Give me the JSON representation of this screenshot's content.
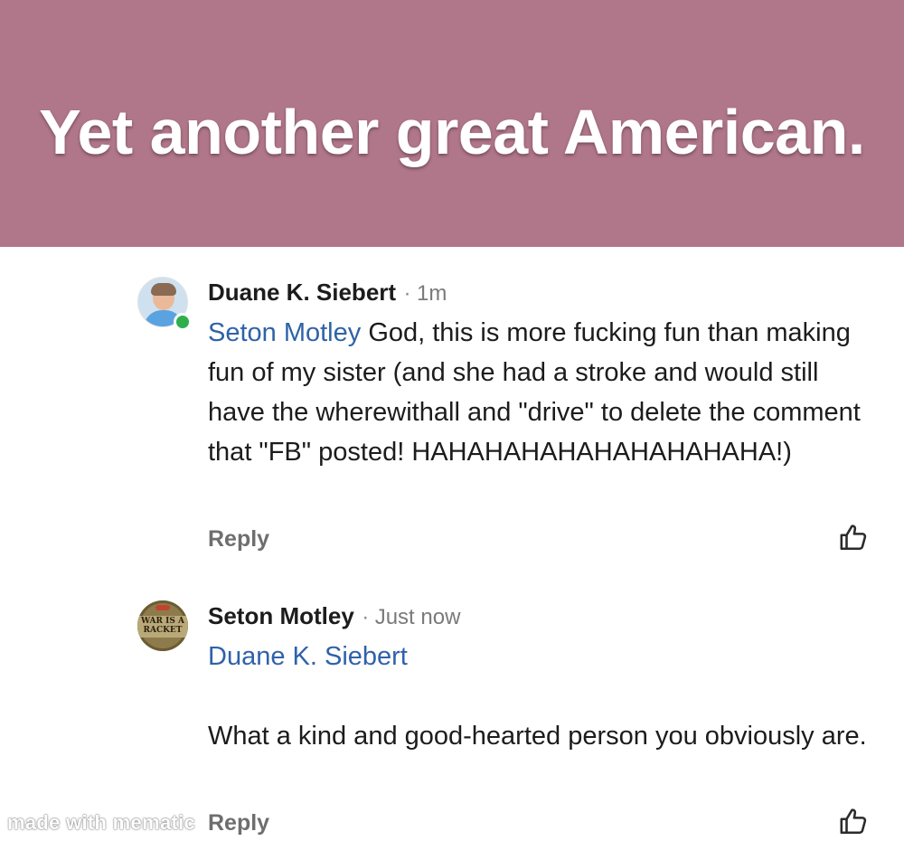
{
  "banner": {
    "title": "Yet another great American.",
    "background_color": "#b07689",
    "title_color": "#ffffff"
  },
  "comments": [
    {
      "author": "Duane K. Siebert",
      "separator": "·",
      "time": "1m",
      "mention": "Seton Motley",
      "text": " God, this is more fucking fun than making fun of my sister (and she had a stroke and would still have the wherewithall and \"drive\" to delete the comment that \"FB\" posted! HAHAHAHAHAHAHAHAHAHA!)",
      "reply_label": "Reply",
      "online": true,
      "avatar_icon": "user-photo-avatar",
      "like_icon": "thumbs-up-icon"
    },
    {
      "author": "Seton Motley",
      "separator": "·",
      "time": "Just now",
      "mention": "Duane K. Siebert",
      "text": "What a kind and good-hearted person you obviously are.",
      "reply_label": "Reply",
      "avatar_text": "WAR IS A RACKET",
      "like_icon": "thumbs-up-icon"
    }
  ],
  "colors": {
    "mention": "#2f62a8",
    "online": "#2eaf4b",
    "muted": "#6e6e6e"
  },
  "watermark": "made with mematic"
}
